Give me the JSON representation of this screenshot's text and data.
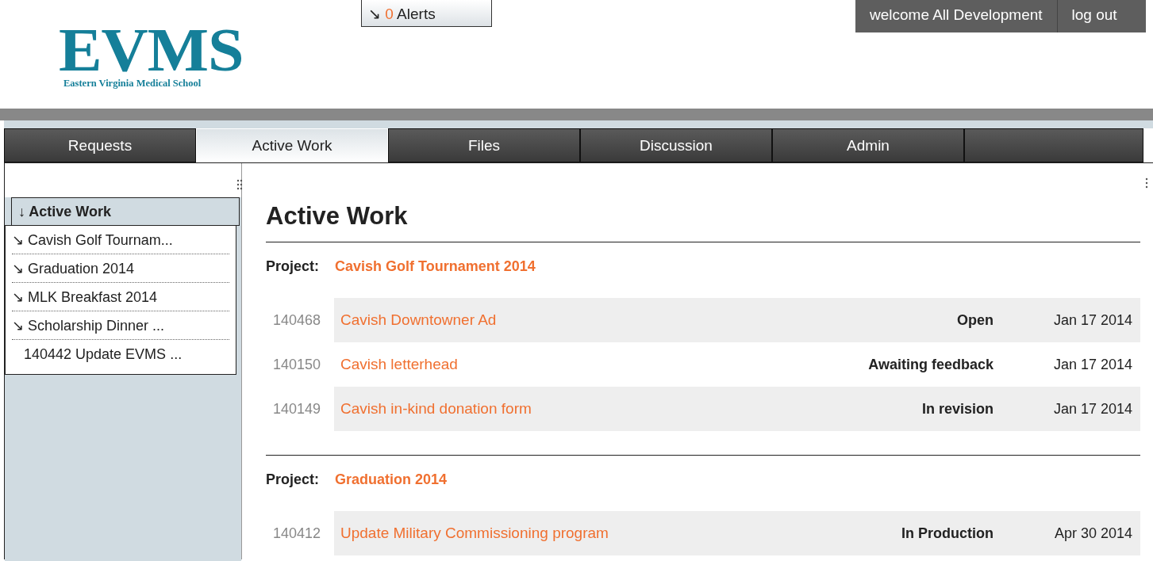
{
  "logo": {
    "wordmark": "EVMS",
    "subtitle": "Eastern Virginia Medical School"
  },
  "alerts": {
    "arrow": "↘",
    "count": "0",
    "label": "Alerts"
  },
  "user_bar": {
    "welcome": "welcome All Development",
    "logout": "log out"
  },
  "tabs": [
    {
      "label": "Requests",
      "selected": false
    },
    {
      "label": "Active Work",
      "selected": true
    },
    {
      "label": "Files",
      "selected": false
    },
    {
      "label": "Discussion",
      "selected": false
    },
    {
      "label": "Admin",
      "selected": false
    },
    {
      "selected": false
    }
  ],
  "sidebar": {
    "header": {
      "arrow": "↓",
      "label": "Active Work"
    },
    "items": [
      {
        "arrow": "↘",
        "label": "Cavish Golf Tournam..."
      },
      {
        "arrow": "↘",
        "label": "Graduation 2014"
      },
      {
        "arrow": "↘",
        "label": "MLK Breakfast 2014"
      },
      {
        "arrow": "↘",
        "label": "Scholarship Dinner ..."
      },
      {
        "label": "140442 Update EVMS ..."
      }
    ]
  },
  "main": {
    "title": "Active Work",
    "projects": [
      {
        "label": "Project:",
        "name": "Cavish Golf Tournament 2014",
        "jobs": [
          {
            "number": "140468",
            "title": "Cavish Downtowner Ad",
            "status": "Open",
            "date": "Jan 17 2014"
          },
          {
            "number": "140150",
            "title": "Cavish letterhead",
            "status": "Awaiting feedback",
            "date": "Jan 17 2014"
          },
          {
            "number": "140149",
            "title": "Cavish in-kind donation form",
            "status": "In revision",
            "date": "Jan 17 2014"
          }
        ]
      },
      {
        "label": "Project:",
        "name": "Graduation 2014",
        "jobs": [
          {
            "number": "140412",
            "title": "Update Military Commissioning program",
            "status": "In Production",
            "date": "Apr 30 2014"
          }
        ]
      }
    ]
  }
}
